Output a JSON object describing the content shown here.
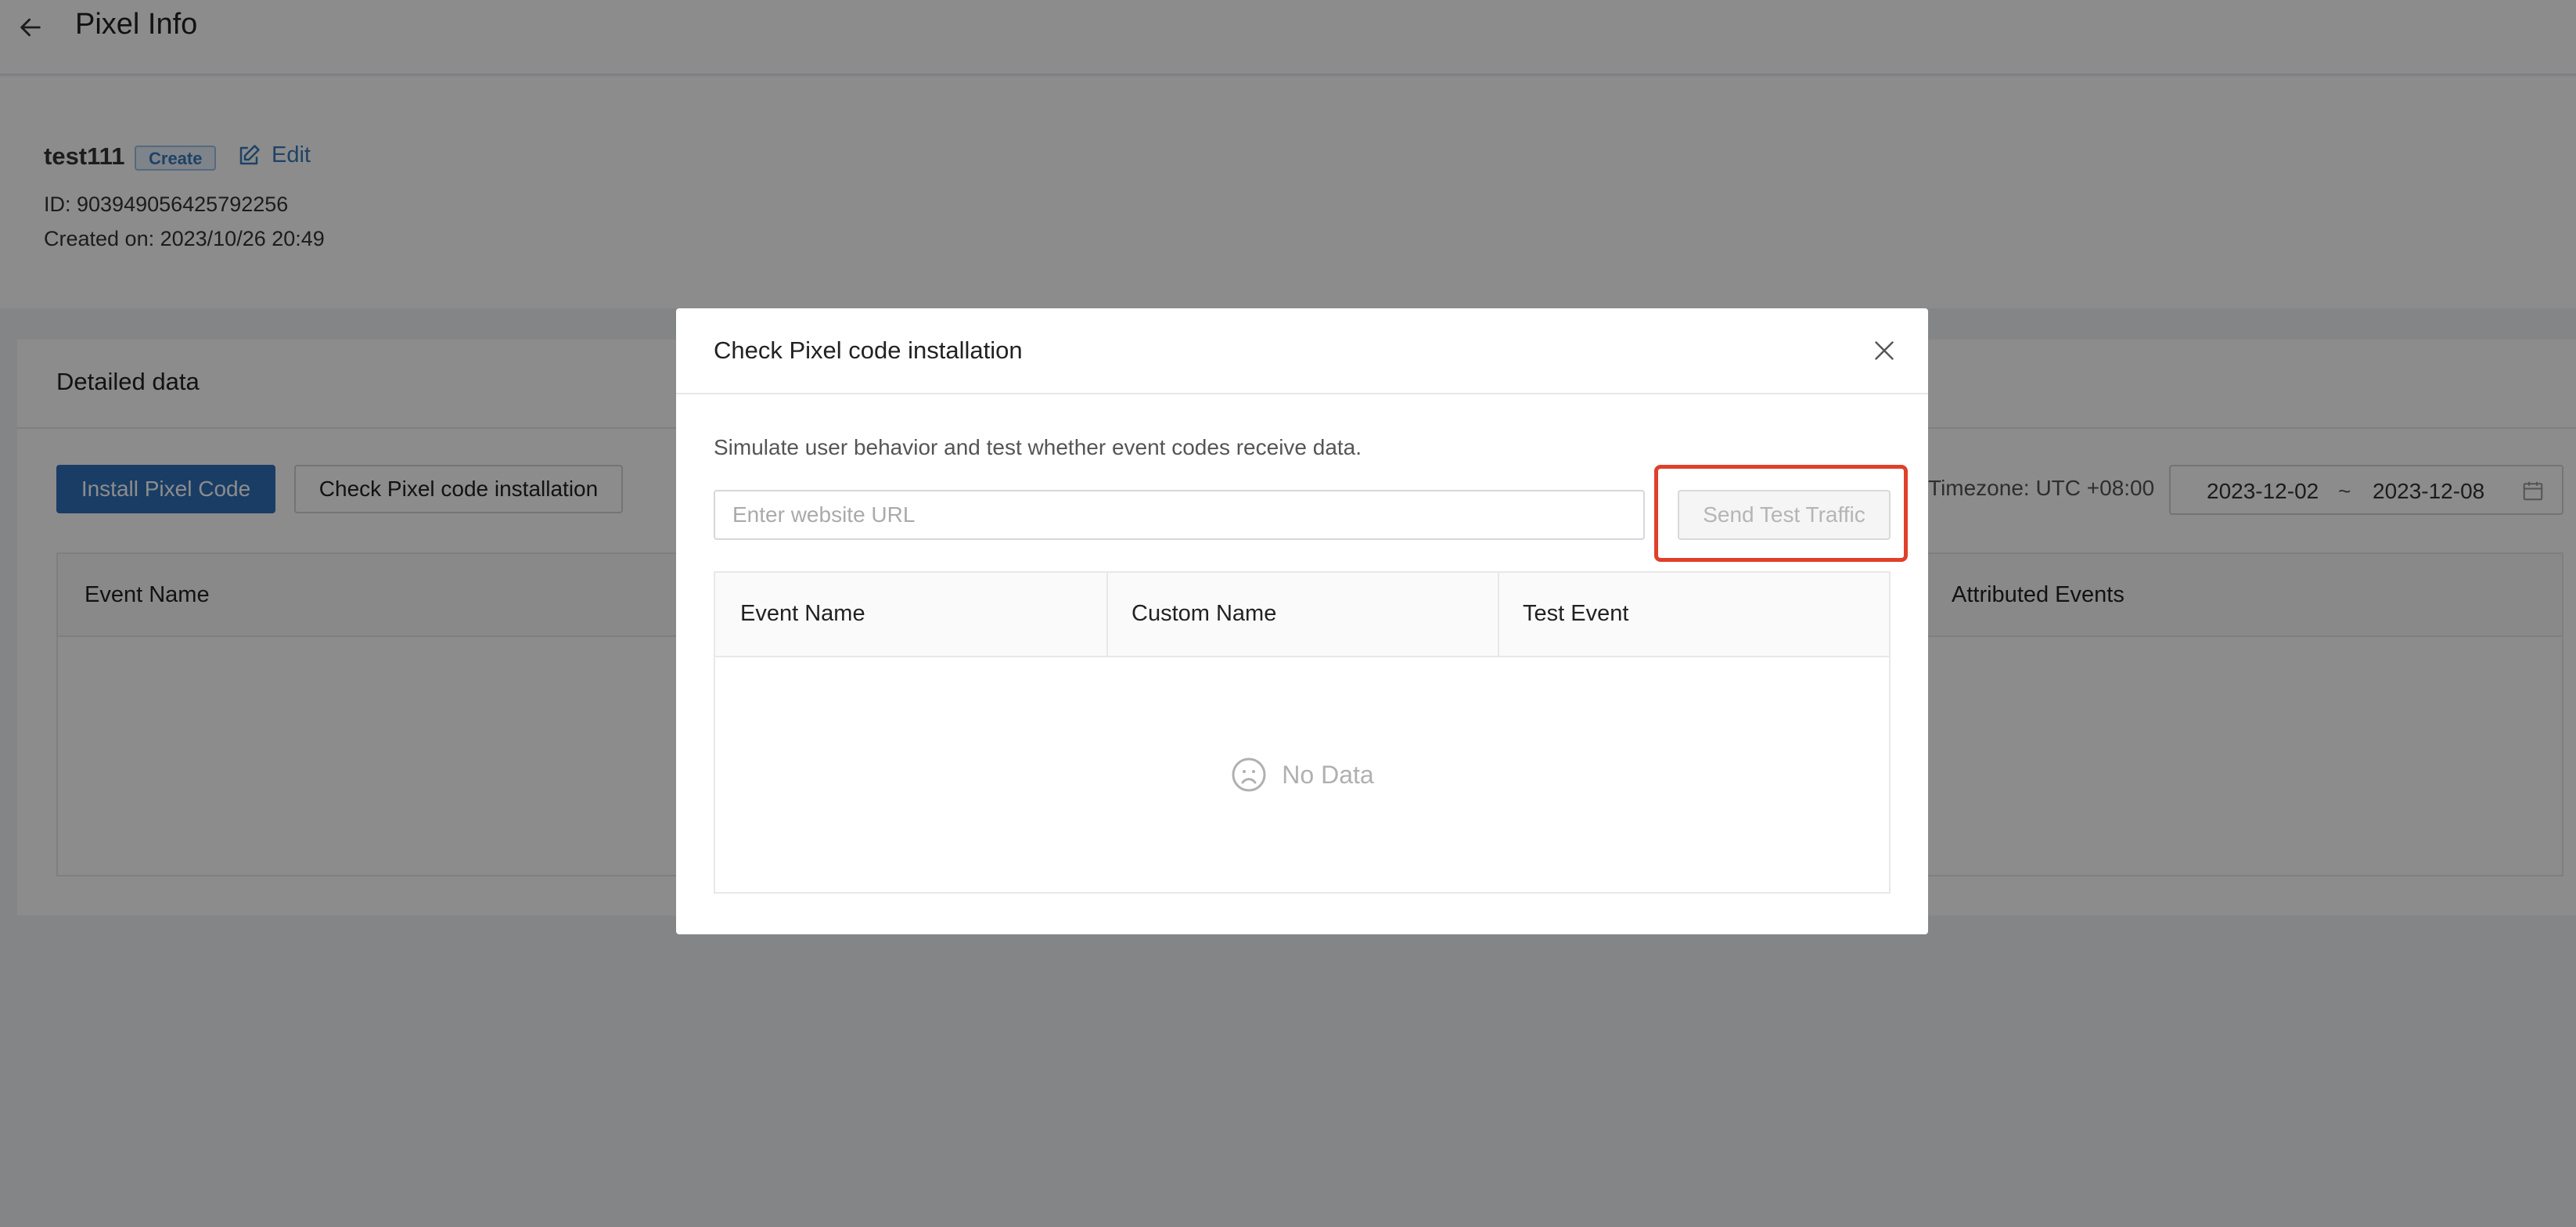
{
  "header": {
    "title": "Pixel Info"
  },
  "pixel": {
    "name": "test111",
    "status_badge": "Create",
    "edit_label": "Edit",
    "id_text": "ID: 903949056425792256",
    "created_text": "Created on: 2023/10/26 20:49"
  },
  "detail": {
    "title": "Detailed data",
    "install_button": "Install Pixel Code",
    "check_button": "Check Pixel code installation",
    "timezone": "Timezone: UTC +08:00",
    "date_start": "2023-12-02",
    "date_separator": "~",
    "date_end": "2023-12-08",
    "table_columns": [
      "Event Name",
      "Attributed Events"
    ]
  },
  "modal": {
    "title": "Check Pixel code installation",
    "description": "Simulate user behavior and test whether event codes receive data.",
    "url_placeholder": "Enter website URL",
    "url_value": "",
    "send_button": "Send Test Traffic",
    "columns": [
      "Event Name",
      "Custom Name",
      "Test Event"
    ],
    "empty_text": "No Data"
  },
  "colors": {
    "primary": "#2f6fb8",
    "highlight": "#e0402a",
    "overlay": "rgba(0,0,0,0.45)"
  },
  "icons": [
    "back-arrow-icon",
    "edit-icon",
    "calendar-icon",
    "close-icon",
    "frown-icon"
  ]
}
